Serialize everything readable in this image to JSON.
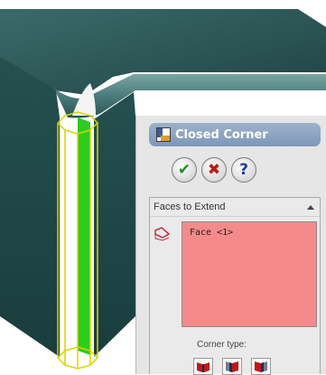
{
  "panel": {
    "title": "Closed Corner",
    "icon": "closed-corner-icon",
    "buttons": [
      {
        "name": "ok",
        "icon": "checkmark-icon",
        "glyph": "✔",
        "color": "#2d8a22"
      },
      {
        "name": "cancel",
        "icon": "x-icon",
        "glyph": "✖",
        "color": "#c01818"
      },
      {
        "name": "help",
        "icon": "question-icon",
        "glyph": "?",
        "color": "#1c3a9a"
      }
    ]
  },
  "faces_group": {
    "title": "Faces to Extend",
    "selection": [
      "Face <1>"
    ],
    "list_color": "#f58a8a"
  },
  "corner_type": {
    "label": "Corner type:",
    "options": [
      "corner-type-butt-icon",
      "corner-type-overlap-icon",
      "corner-type-underlap-icon"
    ]
  },
  "colors": {
    "model_surface": "#2d5454",
    "highlight_green": "#2dcc1e",
    "edge_highlight": "#d8d400",
    "title_bar": "#8aa2c2"
  }
}
